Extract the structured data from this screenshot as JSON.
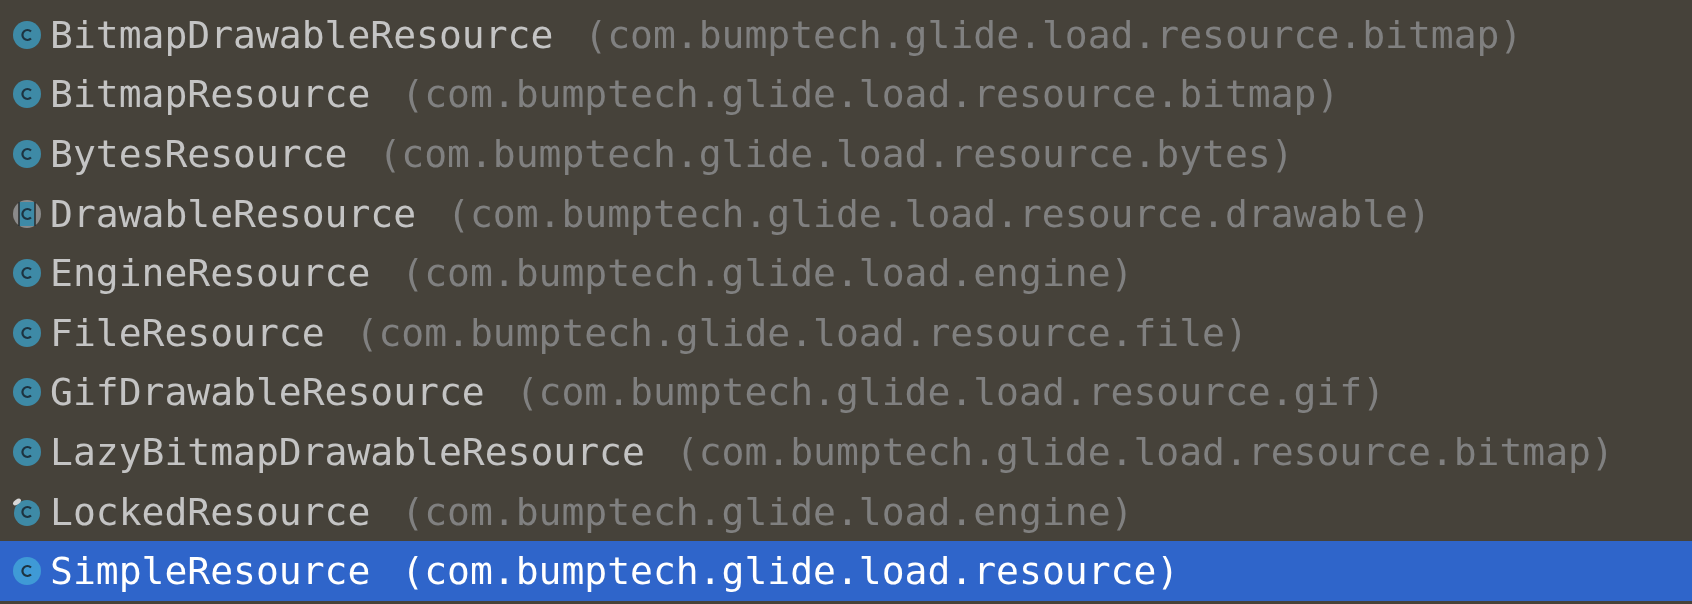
{
  "items": [
    {
      "name": "BitmapDrawableResource",
      "package": "(com.bumptech.glide.load.resource.bitmap)",
      "kind": "class",
      "selected": false
    },
    {
      "name": "BitmapResource",
      "package": "(com.bumptech.glide.load.resource.bitmap)",
      "kind": "class",
      "selected": false
    },
    {
      "name": "BytesResource",
      "package": "(com.bumptech.glide.load.resource.bytes)",
      "kind": "class",
      "selected": false
    },
    {
      "name": "DrawableResource",
      "package": "(com.bumptech.glide.load.resource.drawable)",
      "kind": "abstract",
      "selected": false
    },
    {
      "name": "EngineResource",
      "package": "(com.bumptech.glide.load.engine)",
      "kind": "class",
      "selected": false
    },
    {
      "name": "FileResource",
      "package": "(com.bumptech.glide.load.resource.file)",
      "kind": "class",
      "selected": false
    },
    {
      "name": "GifDrawableResource",
      "package": "(com.bumptech.glide.load.resource.gif)",
      "kind": "class",
      "selected": false
    },
    {
      "name": "LazyBitmapDrawableResource",
      "package": "(com.bumptech.glide.load.resource.bitmap)",
      "kind": "class",
      "selected": false
    },
    {
      "name": "LockedResource",
      "package": "(com.bumptech.glide.load.engine)",
      "kind": "final",
      "selected": false
    },
    {
      "name": "SimpleResource",
      "package": "(com.bumptech.glide.load.resource)",
      "kind": "class",
      "selected": true
    }
  ]
}
